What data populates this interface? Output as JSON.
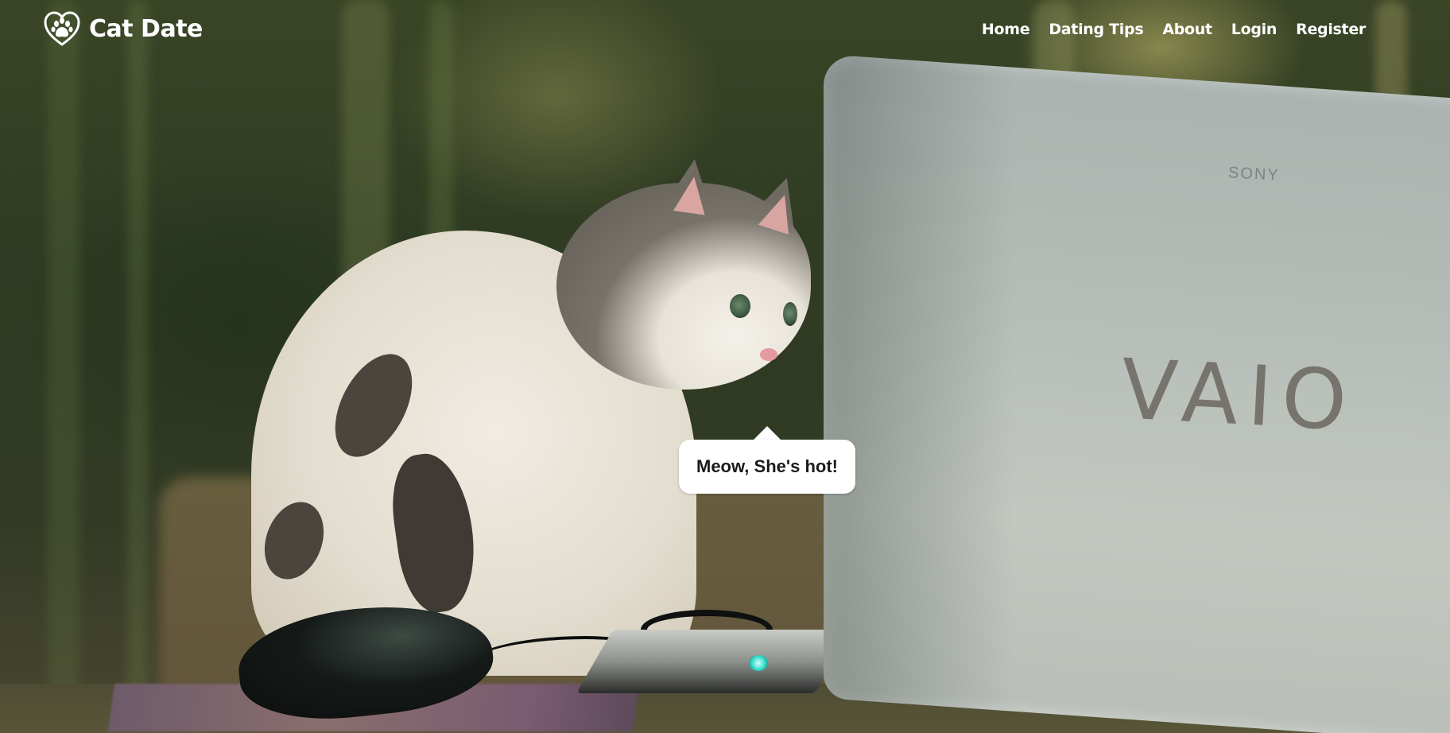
{
  "brand": {
    "name": "Cat Date",
    "logo_icon": "heart-paw-icon"
  },
  "nav": {
    "items": [
      {
        "label": "Home"
      },
      {
        "label": "Dating Tips"
      },
      {
        "label": "About"
      },
      {
        "label": "Login"
      },
      {
        "label": "Register"
      }
    ]
  },
  "hero": {
    "bubble_text": "Meow, She's hot!",
    "laptop_brand_small": "SONY",
    "laptop_brand_large": "VAIO"
  },
  "colors": {
    "nav_text": "#ffffff",
    "bubble_bg": "#ffffff",
    "bubble_text": "#1b1b1b"
  }
}
